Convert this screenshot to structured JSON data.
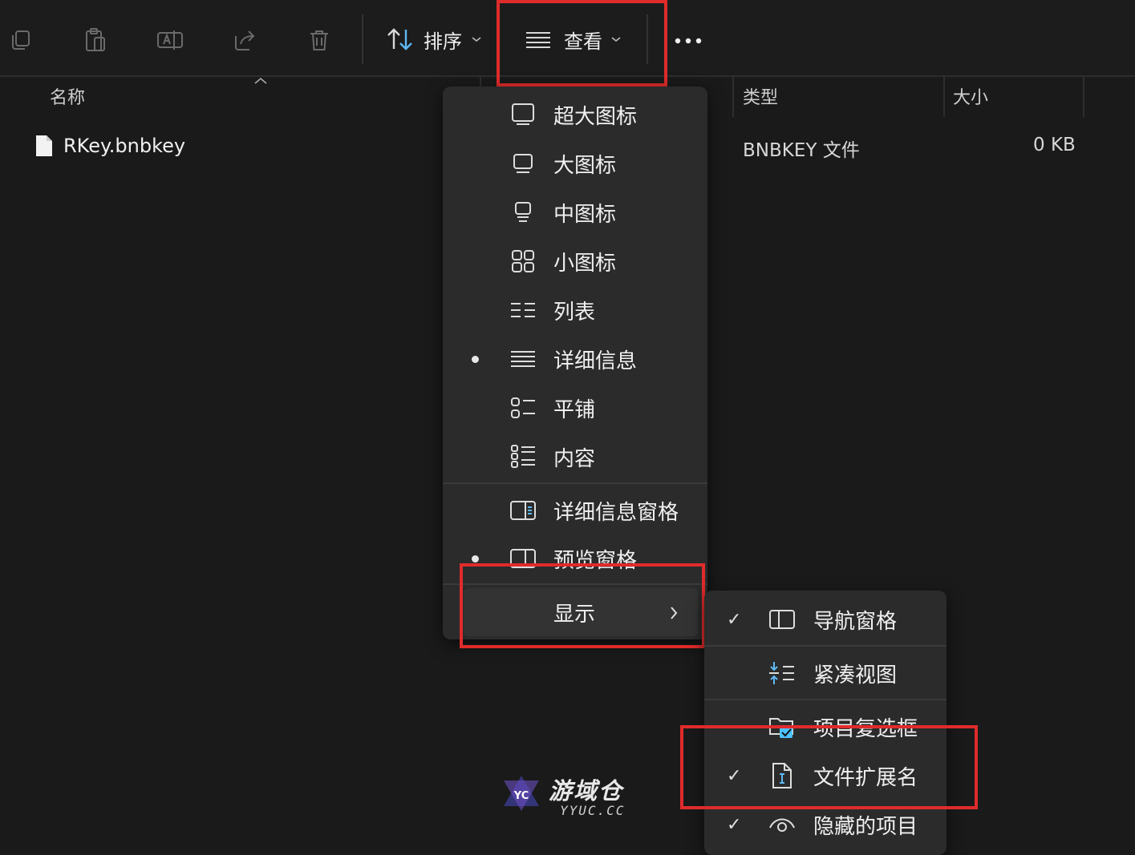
{
  "toolbar": {
    "sort_label": "排序",
    "view_label": "查看",
    "more_label": "···"
  },
  "columns": {
    "name": "名称",
    "type": "类型",
    "size": "大小"
  },
  "file": {
    "name": "RKey.bnbkey",
    "type": "BNBKEY 文件",
    "size": "0 KB"
  },
  "view_menu": {
    "items": [
      {
        "label": "超大图标",
        "icon": "extra-large-icons-icon",
        "selected": false
      },
      {
        "label": "大图标",
        "icon": "large-icons-icon",
        "selected": false
      },
      {
        "label": "中图标",
        "icon": "medium-icons-icon",
        "selected": false
      },
      {
        "label": "小图标",
        "icon": "small-icons-icon",
        "selected": false
      },
      {
        "label": "列表",
        "icon": "list-icon",
        "selected": false
      },
      {
        "label": "详细信息",
        "icon": "details-icon",
        "selected": true
      },
      {
        "label": "平铺",
        "icon": "tiles-icon",
        "selected": false
      },
      {
        "label": "内容",
        "icon": "content-icon",
        "selected": false
      }
    ],
    "panes": [
      {
        "label": "详细信息窗格",
        "icon": "details-pane-icon",
        "selected": false
      },
      {
        "label": "预览窗格",
        "icon": "preview-pane-icon",
        "selected": true
      }
    ],
    "show_label": "显示"
  },
  "show_submenu": {
    "items": [
      {
        "label": "导航窗格",
        "icon": "navigation-pane-icon",
        "checked": true
      },
      {
        "label": "紧凑视图",
        "icon": "compact-view-icon",
        "checked": false
      },
      {
        "label": "项目复选框",
        "icon": "item-checkboxes-icon",
        "checked": false
      },
      {
        "label": "文件扩展名",
        "icon": "file-extension-icon",
        "checked": true
      },
      {
        "label": "隐藏的项目",
        "icon": "hidden-items-icon",
        "checked": true
      }
    ],
    "check_glyph": "✓"
  },
  "watermark": {
    "title": "游域仓",
    "url": "YYUC.CC"
  },
  "colors": {
    "highlight_red": "#e02b2b",
    "accent_blue": "#4cc2ff"
  }
}
